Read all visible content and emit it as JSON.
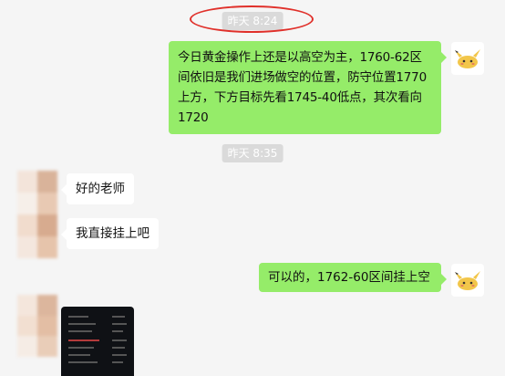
{
  "chat": {
    "timestamp_1": "昨天 8:24",
    "timestamp_2": "昨天 8:35",
    "messages": [
      {
        "text": "今日黄金操作上还是以高空为主，1760-62区间依旧是我们进场做空的位置，防守位置1770上方，下方目标先看1745-40低点，其次看向1720",
        "side": "outgoing"
      },
      {
        "text": "好的老师",
        "side": "incoming"
      },
      {
        "text": "我直接挂上吧",
        "side": "incoming"
      },
      {
        "text": "可以的，1762-60区间挂上空",
        "side": "outgoing"
      }
    ],
    "my_avatar_icon": "cartoon-pikachu-icon",
    "attachment_icon": "phone-screenshot-thumbnail"
  },
  "colors": {
    "background": "#f5f5f5",
    "outgoing_bubble": "#95ec69",
    "incoming_bubble": "#ffffff",
    "timestamp_bg": "#dadada",
    "annotation_circle": "#e0302a"
  }
}
